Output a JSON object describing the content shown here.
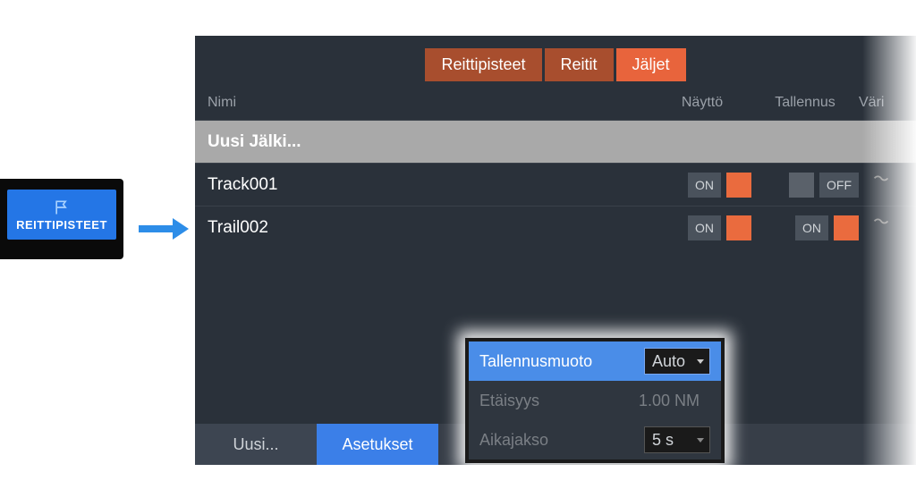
{
  "menu": {
    "waypoints_label": "REITTIPISTEET"
  },
  "tabs": {
    "waypoints": "Reittipisteet",
    "routes": "Reitit",
    "trails": "Jäljet"
  },
  "columns": {
    "name": "Nimi",
    "display": "Näyttö",
    "save": "Tallennus",
    "color": "Väri"
  },
  "rows": {
    "new_trail": "Uusi Jälki...",
    "items": [
      {
        "name": "Track001",
        "display": "ON",
        "save": "OFF"
      },
      {
        "name": "Trail002",
        "display": "ON",
        "save": "ON"
      }
    ]
  },
  "toolbar": {
    "new": "Uusi...",
    "settings": "Asetukset"
  },
  "settings": {
    "save_format_label": "Tallennusmuoto",
    "save_format_value": "Auto",
    "distance_label": "Etäisyys",
    "distance_value": "1.00 NM",
    "period_label": "Aikajakso",
    "period_value": "5 s"
  }
}
